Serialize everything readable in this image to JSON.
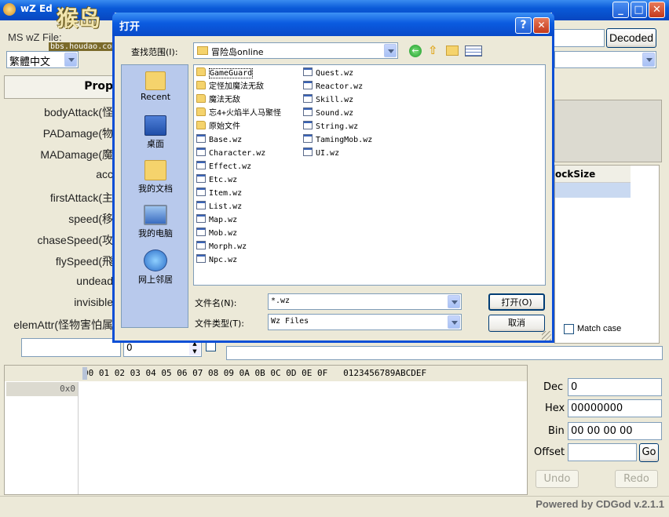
{
  "main": {
    "title": "wZ Ed",
    "watermark": "猴岛",
    "watermark_url": "bbs.houdao.com",
    "file_label": "MS wZ File:",
    "decoded_button": "Decoded",
    "language_select": "繁體中文",
    "props_header": "Prop",
    "props": [
      "bodyAttack(怪",
      "PADamage(物",
      "MADamage(魔",
      "acc",
      "firstAttack(主",
      "speed(移",
      "chaseSpeed(攻",
      "flySpeed(飛",
      "undead",
      "invisible",
      "elemAttr(怪物害怕属"
    ],
    "stepper_value": "0",
    "grid_col_header": "ockSize",
    "match_case_label": "Match case",
    "hex_header": "00 01 02 03 04 05 06 07 08 09 0A 0B 0C 0D 0E 0F   0123456789ABCDEF",
    "hex_offset": "0x0",
    "dec_label": "Dec",
    "dec_value": "0",
    "hex_label": "Hex",
    "hex_value": "00000000",
    "bin_label": "Bin",
    "bin_value": "00 00 00 00",
    "offset_label": "Offset",
    "go_button": "Go",
    "undo_button": "Undo",
    "redo_button": "Redo",
    "status_text": "Powered by CDGod v.2.1.1"
  },
  "dialog": {
    "title": "打开",
    "help_btn": "?",
    "close_btn": "✕",
    "lookin_label": "查找范围(I):",
    "lookin_value": "冒险岛online",
    "places": [
      "Recent",
      "桌面",
      "我的文档",
      "我的电脑",
      "网上邻居"
    ],
    "files_col1": [
      {
        "name": "GameGuard",
        "type": "folder"
      },
      {
        "name": "定怪加魔法无敌",
        "type": "folder"
      },
      {
        "name": "魔法无敌",
        "type": "folder"
      },
      {
        "name": "忘4+火焰半人马聚怪",
        "type": "folder"
      },
      {
        "name": "原始文件",
        "type": "folder"
      },
      {
        "name": "Base.wz",
        "type": "wz"
      },
      {
        "name": "Character.wz",
        "type": "wz"
      },
      {
        "name": "Effect.wz",
        "type": "wz"
      },
      {
        "name": "Etc.wz",
        "type": "wz"
      },
      {
        "name": "Item.wz",
        "type": "wz"
      },
      {
        "name": "List.wz",
        "type": "wz"
      },
      {
        "name": "Map.wz",
        "type": "wz"
      },
      {
        "name": "Mob.wz",
        "type": "wz"
      },
      {
        "name": "Morph.wz",
        "type": "wz"
      },
      {
        "name": "Npc.wz",
        "type": "wz"
      }
    ],
    "files_col2": [
      {
        "name": "Quest.wz",
        "type": "wz"
      },
      {
        "name": "Reactor.wz",
        "type": "wz"
      },
      {
        "name": "Skill.wz",
        "type": "wz"
      },
      {
        "name": "Sound.wz",
        "type": "wz"
      },
      {
        "name": "String.wz",
        "type": "wz"
      },
      {
        "name": "TamingMob.wz",
        "type": "wz"
      },
      {
        "name": "UI.wz",
        "type": "wz"
      }
    ],
    "filename_label": "文件名(N):",
    "filename_value": "*.wz",
    "filetype_label": "文件类型(T):",
    "filetype_value": "Wz Files",
    "open_button": "打开(O)",
    "cancel_button": "取消"
  }
}
